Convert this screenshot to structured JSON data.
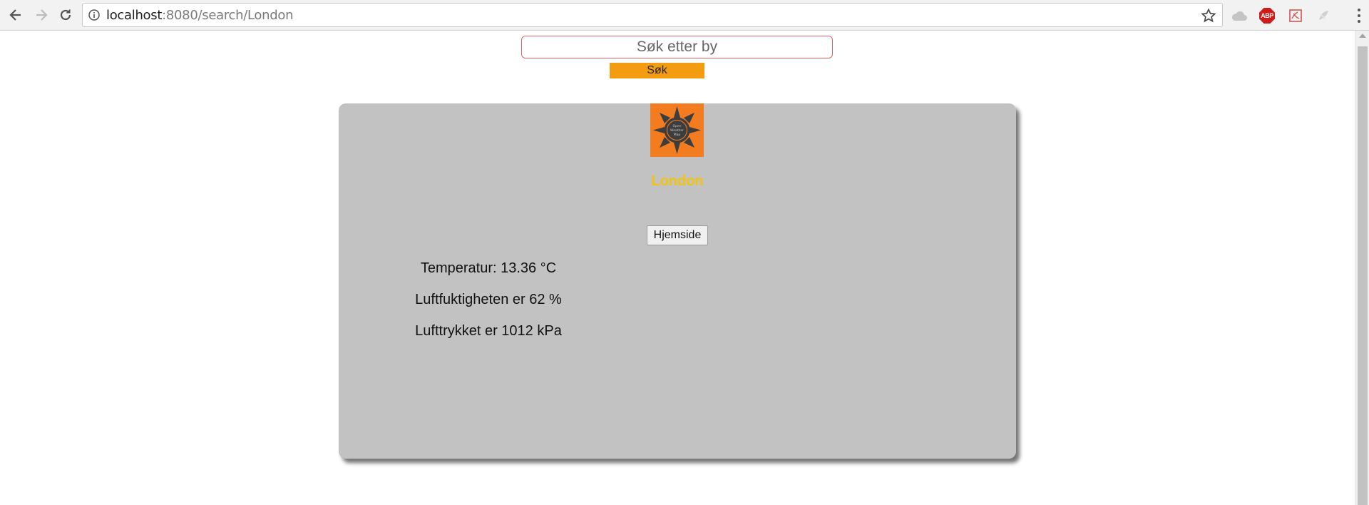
{
  "browser": {
    "url_host": "localhost",
    "url_rest": ":8080/search/London",
    "icons": [
      "back-arrow-icon",
      "forward-arrow-icon",
      "reload-icon",
      "info-icon",
      "star-icon",
      "cloud-extension-icon",
      "adblock-plus-icon",
      "pdf-extension-icon",
      "extension-icon",
      "menu-dots-icon"
    ],
    "abp_text": "ABP"
  },
  "search": {
    "placeholder": "Søk etter by",
    "button_label": "Søk"
  },
  "weather": {
    "logo_text": "Open Weather Map",
    "city": "London",
    "home_button_label": "Hjemside",
    "temperature_text": "Temperatur: 13.36 °C",
    "humidity_text": "Luftfuktigheten er 62 %",
    "pressure_text": "Lufttrykket er 1012 kPa"
  },
  "colors": {
    "accent_orange": "#f39c12",
    "logo_orange": "#f47c20",
    "city_yellow": "#f1c40f",
    "card_gray": "#c2c2c2",
    "input_border": "#e06666"
  }
}
